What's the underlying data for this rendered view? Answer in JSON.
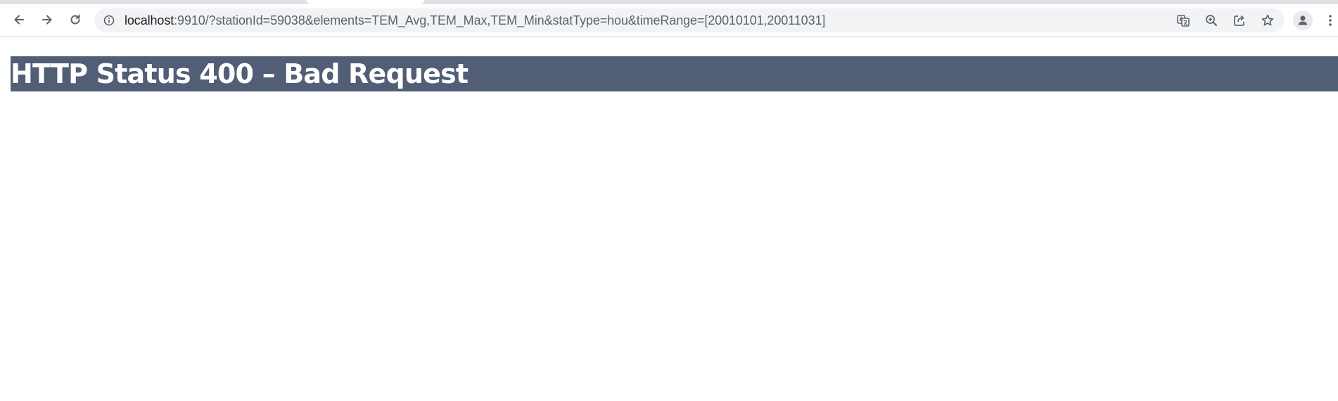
{
  "browser": {
    "url_host": "localhost",
    "url_rest": ":9910/?stationId=59038&elements=TEM_Avg,TEM_Max,TEM_Min&statType=hou&timeRange=[20010101,20011031]",
    "icons": {
      "back": "arrow-left-icon",
      "forward": "arrow-right-icon",
      "reload": "reload-icon",
      "site_info": "info-icon",
      "translate": "translate-icon",
      "zoom": "zoom-icon",
      "share": "share-icon",
      "bookmark": "star-icon",
      "profile": "person-icon",
      "menu": "kebab-menu-icon"
    }
  },
  "page": {
    "heading": "HTTP Status 400 – Bad Request"
  },
  "colors": {
    "heading_bg": "#525d76",
    "heading_text": "#ffffff",
    "omnibox_bg": "#f1f3f4",
    "icon_color": "#5f6368"
  }
}
